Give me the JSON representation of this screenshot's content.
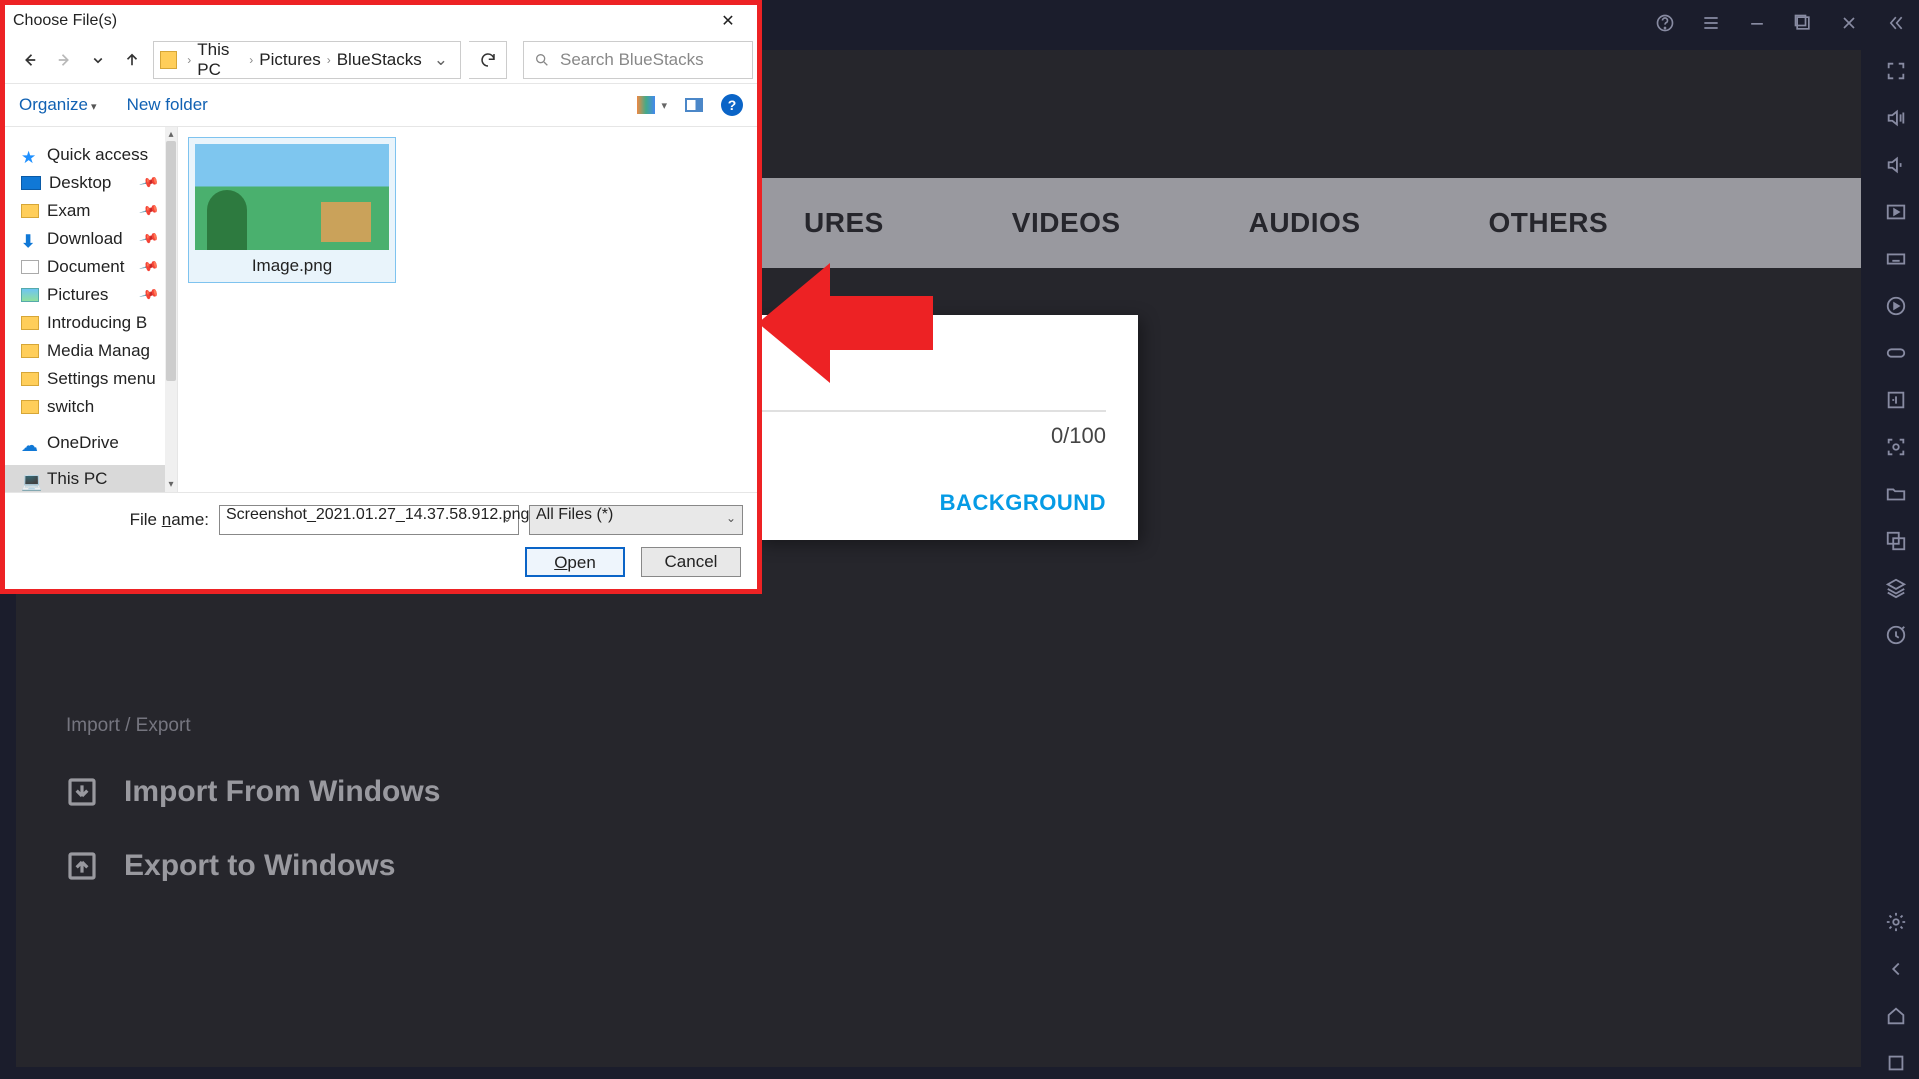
{
  "bluestacks": {
    "tabs": {
      "videos": "VIDEOS",
      "audios": "AUDIOS",
      "others": "OTHERS",
      "pictures_partial": "URES"
    },
    "popup": {
      "count": "0/100",
      "background": "BACKGROUND"
    },
    "import_section_title": "Import / Export",
    "import_label": "Import From Windows",
    "export_label": "Export to Windows"
  },
  "dialog": {
    "title": "Choose File(s)",
    "breadcrumb": {
      "root": "This PC",
      "p1": "Pictures",
      "p2": "BlueStacks"
    },
    "search_placeholder": "Search BlueStacks",
    "organize": "Organize",
    "new_folder": "New folder",
    "sidebar": {
      "quick": "Quick access",
      "desktop": "Desktop",
      "exam": "Exam",
      "download": "Download",
      "document": "Document",
      "pictures": "Pictures",
      "intro": "Introducing B",
      "media": "Media Manag",
      "settings": "Settings menu",
      "switch": "switch",
      "onedrive": "OneDrive",
      "thispc": "This PC"
    },
    "file_thumb": "Image.png",
    "file_name_label": "File name:",
    "file_name_value": "Screenshot_2021.01.27_14.37.58.912.png",
    "file_name_first": "n",
    "filter": "All Files (*)",
    "open": "pen",
    "open_first": "O",
    "cancel": "Cancel"
  }
}
